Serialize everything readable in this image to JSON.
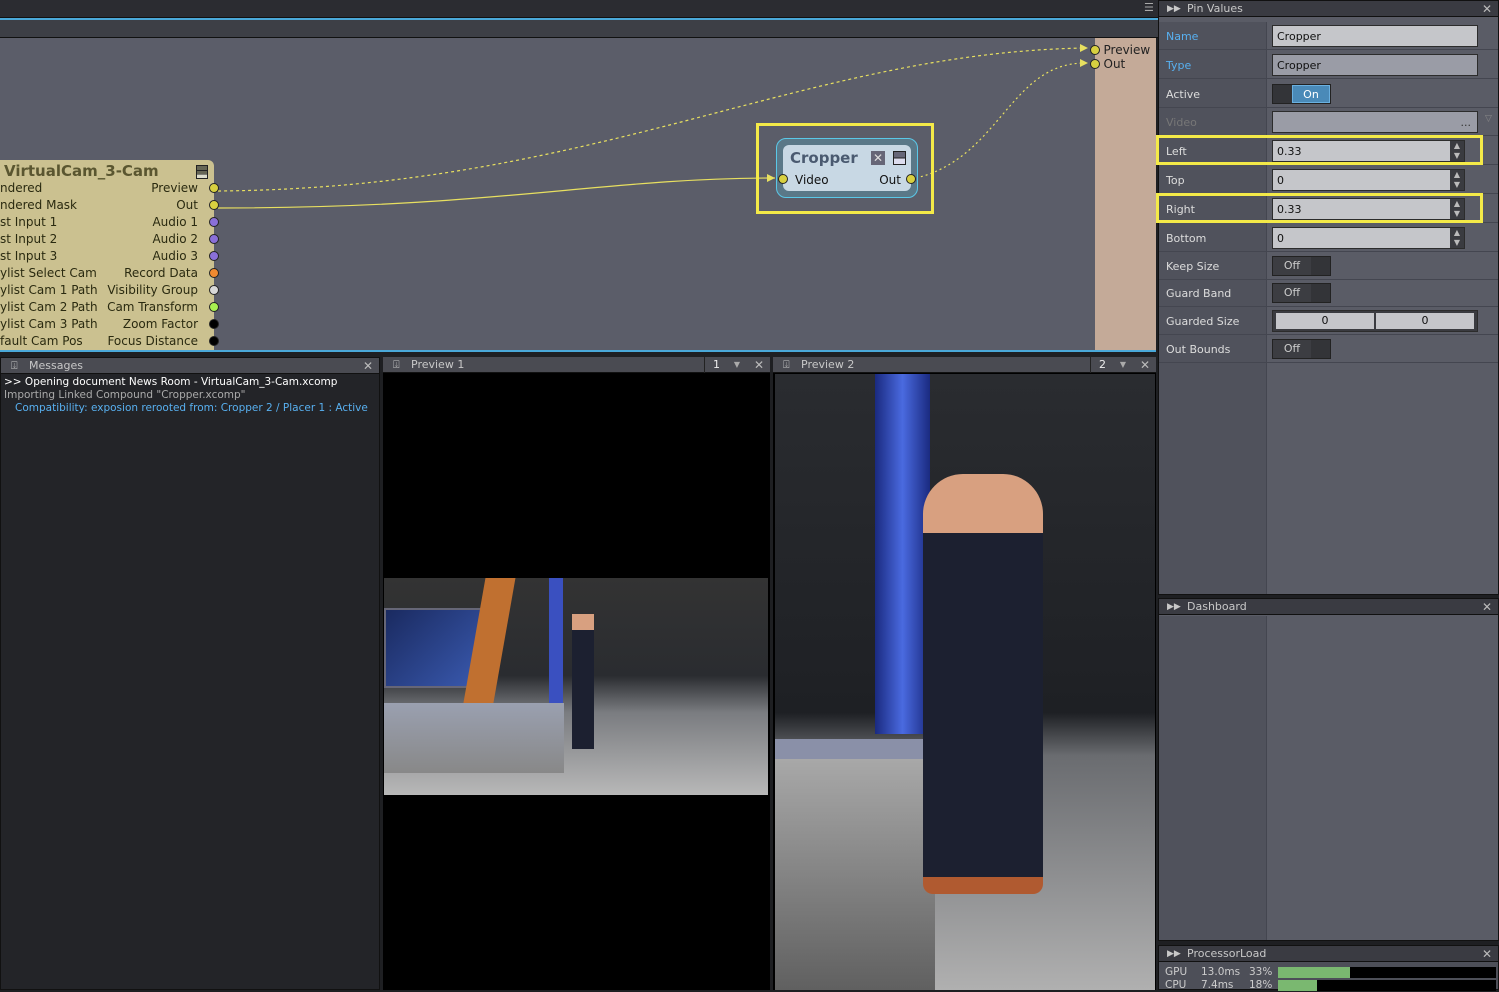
{
  "graph": {
    "main_node": {
      "title": "VirtualCam_3-Cam",
      "inputs": [
        "ndered",
        "ndered Mask",
        "st Input 1",
        "st Input 2",
        "st Input 3",
        "ylist Select Cam",
        "ylist Cam 1 Path",
        "ylist Cam 2 Path",
        "ylist Cam 3 Path",
        "fault Cam Pos"
      ],
      "outputs": [
        {
          "label": "Preview",
          "color": "#d8d040"
        },
        {
          "label": "Out",
          "color": "#d8d040"
        },
        {
          "label": "Audio 1",
          "color": "#8a70d8"
        },
        {
          "label": "Audio 2",
          "color": "#8a70d8"
        },
        {
          "label": "Audio 3",
          "color": "#8a70d8"
        },
        {
          "label": "Record Data",
          "color": "#f08a30"
        },
        {
          "label": "Visibility Group",
          "color": "#d8d8d8"
        },
        {
          "label": "Cam Transform",
          "color": "#a8f050"
        },
        {
          "label": "Zoom Factor",
          "color": "#000000"
        },
        {
          "label": "Focus Distance",
          "color": "#000000"
        }
      ]
    },
    "cropper_node": {
      "title": "Cropper",
      "input": "Video",
      "output": "Out"
    },
    "compound_outputs": [
      "Preview",
      "Out"
    ]
  },
  "messages": {
    "title": "Messages",
    "lines": [
      ">> Opening document News Room - VirtualCam_3-Cam.xcomp",
      "Importing Linked Compound \"Cropper.xcomp\"",
      "Compatibility: exposion rerooted from: Cropper 2 / Placer 1 : Active"
    ]
  },
  "preview1": {
    "title": "Preview 1",
    "index": "1"
  },
  "preview2": {
    "title": "Preview 2",
    "index": "2"
  },
  "pin_values": {
    "title": "Pin Values",
    "name": {
      "label": "Name",
      "value": "Cropper"
    },
    "type": {
      "label": "Type",
      "value": "Cropper"
    },
    "active": {
      "label": "Active",
      "value": "On"
    },
    "video": {
      "label": "Video",
      "value": "..."
    },
    "left": {
      "label": "Left",
      "value": "0.33"
    },
    "top": {
      "label": "Top",
      "value": "0"
    },
    "right": {
      "label": "Right",
      "value": "0.33"
    },
    "bottom": {
      "label": "Bottom",
      "value": "0"
    },
    "keep_size": {
      "label": "Keep Size",
      "value": "Off"
    },
    "guard_band": {
      "label": "Guard Band",
      "value": "Off"
    },
    "guarded_size": {
      "label": "Guarded Size",
      "values": [
        "0",
        "0"
      ]
    },
    "out_bounds": {
      "label": "Out Bounds",
      "value": "Off"
    }
  },
  "dashboard": {
    "title": "Dashboard"
  },
  "processor_load": {
    "title": "ProcessorLoad",
    "rows": [
      {
        "label": "GPU",
        "time": "13.0ms",
        "percent": "33%",
        "fraction": 0.33
      },
      {
        "label": "CPU",
        "time": "7.4ms",
        "percent": "18%",
        "fraction": 0.18
      }
    ]
  },
  "colors": {
    "accent": "#4aa8d8",
    "highlight": "#f4ea48",
    "link": "#e8e060"
  }
}
